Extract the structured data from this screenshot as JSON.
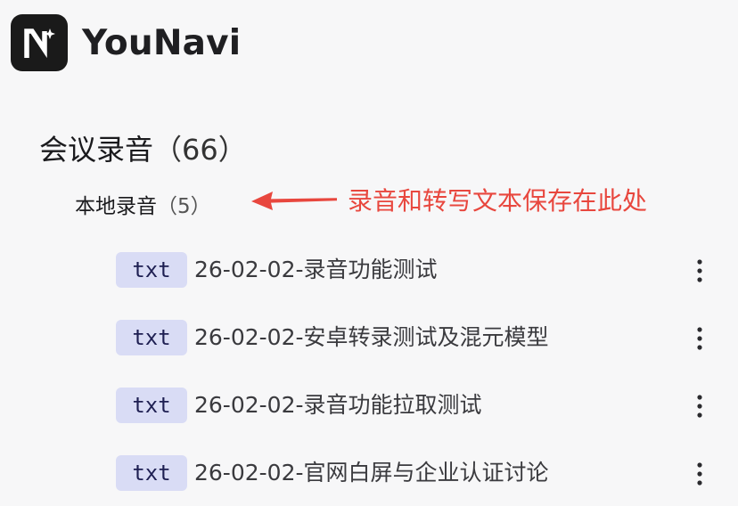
{
  "header": {
    "app_name": "YouNavi",
    "logo_letter": "N",
    "logo_icon": "sparkle-icon"
  },
  "section": {
    "title": "会议录音",
    "count": "（66）"
  },
  "subfolder": {
    "title": "本地录音",
    "count": "（5）"
  },
  "annotation": {
    "text": "录音和转写文本保存在此处",
    "color": "#e8473e",
    "icon": "arrow-left-icon"
  },
  "files": [
    {
      "type": "txt",
      "name": "26-02-02-录音功能测试"
    },
    {
      "type": "txt",
      "name": "26-02-02-安卓转录测试及混元模型"
    },
    {
      "type": "txt",
      "name": "26-02-02-录音功能拉取测试"
    },
    {
      "type": "txt",
      "name": "26-02-02-官网白屏与企业认证讨论"
    }
  ],
  "colors": {
    "badge_bg": "#d9dcf5",
    "badge_text": "#1e1f52",
    "logo_bg": "#1a1a1a"
  }
}
